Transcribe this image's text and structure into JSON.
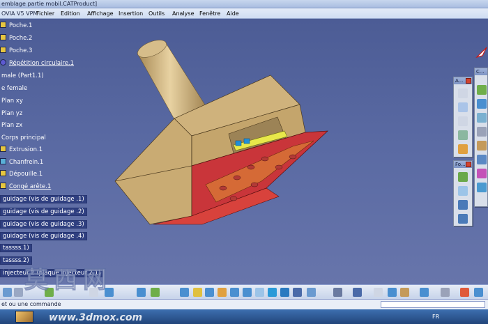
{
  "window": {
    "title": "emblage partie mobil.CATProduct]"
  },
  "menubar": {
    "app": "OVIA V5 VPM",
    "items": [
      "Fichier",
      "Edition",
      "Affichage",
      "Insertion",
      "Outils",
      "Analyse",
      "Fenêtre",
      "Aide"
    ]
  },
  "tree": {
    "items": [
      {
        "label": "Poche.1",
        "icon": "pocket-icon"
      },
      {
        "label": "Poche.2",
        "icon": "pocket-icon"
      },
      {
        "label": "Poche.3",
        "icon": "pocket-icon"
      },
      {
        "label": "Répétition circulaire.1",
        "icon": "circular-pattern-icon"
      },
      {
        "label": "male (Part1.1)",
        "icon": ""
      },
      {
        "label": "e female",
        "icon": ""
      },
      {
        "label": "Plan xy",
        "icon": ""
      },
      {
        "label": "Plan yz",
        "icon": ""
      },
      {
        "label": "Plan zx",
        "icon": ""
      },
      {
        "label": "Corps principal",
        "icon": ""
      },
      {
        "label": "Extrusion.1",
        "icon": "pad-icon"
      },
      {
        "label": "Chanfrein.1",
        "icon": "chamfer-icon"
      },
      {
        "label": "Dépouille.1",
        "icon": "draft-icon"
      },
      {
        "label": "Congé arête.1",
        "icon": "fillet-icon"
      },
      {
        "label": "guidage  (vis de guidage .1)",
        "icon": ""
      },
      {
        "label": "guidage  (vis de guidage .2)",
        "icon": ""
      },
      {
        "label": "guidage  (vis de guidage .3)",
        "icon": ""
      },
      {
        "label": "guidage  (vis de guidage .4)",
        "icon": ""
      },
      {
        "label": "tassss.1)",
        "icon": ""
      },
      {
        "label": "tassss.2)",
        "icon": ""
      },
      {
        "label": "injecteur 2 (plaque injecteur 2.1)",
        "icon": ""
      }
    ]
  },
  "toolbars": {
    "a": {
      "title": "A..."
    },
    "c": {
      "title": "C..."
    },
    "fo": {
      "title": "Fo..."
    }
  },
  "commandline": {
    "text": "et ou une commande"
  },
  "taskbar": {
    "lang": "FR"
  },
  "watermark": {
    "chinese": "莫西网",
    "url": "www.3dmox.com"
  },
  "colors": {
    "background": "#5262a0",
    "part_tan": "#c9ab73",
    "part_red": "#c9353a",
    "tree_box": "#2f3f80"
  }
}
